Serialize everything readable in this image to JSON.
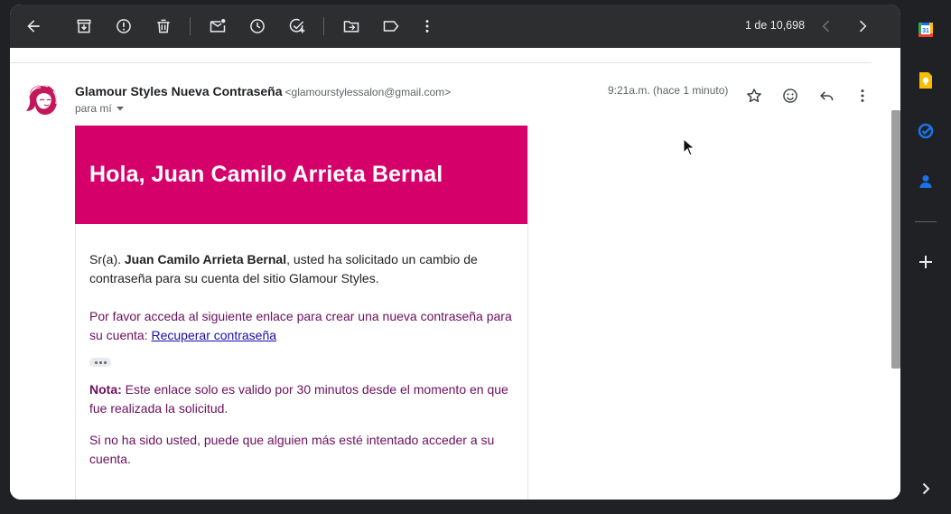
{
  "toolbar": {
    "pager_text": "1 de 10,698"
  },
  "message": {
    "sender_name": "Glamour Styles Nueva Contraseña",
    "sender_email": "<glamourstylessalon@gmail.com>",
    "recipient": "para mí",
    "time": "9:21a.m. (hace 1 minuto)"
  },
  "email_body": {
    "banner_title": "Hola, Juan Camilo Arrieta Bernal",
    "greeting_prefix": "Sr(a). ",
    "greeting_name": "Juan Camilo Arrieta Bernal",
    "greeting_rest": ", usted ha solicitado un cambio de contraseña para su cuenta del sitio Glamour Styles.",
    "instruction": "Por favor acceda al siguiente enlace para crear una nueva contraseña para su cuenta: ",
    "link_text": "Recuperar contraseña",
    "note_label": "Nota:",
    "note_text": " Este enlace solo es valido por 30 minutos desde el momento en que fue realizada la solicitud.",
    "warning": "Si no ha sido usted, puede que alguien más esté intentado acceder a su cuenta."
  },
  "colors": {
    "banner": "#d6006b",
    "body_purple": "#6b0f5e",
    "toolbar_bg": "#2d2e30",
    "page_bg": "#202124"
  },
  "icons": {
    "toolbar": [
      "back-arrow-icon",
      "archive-icon",
      "report-spam-icon",
      "delete-icon",
      "mark-unread-icon",
      "snooze-icon",
      "add-task-icon",
      "move-to-icon",
      "label-icon",
      "more-vert-icon",
      "chevron-left-icon",
      "chevron-right-icon"
    ],
    "header": [
      "star-icon",
      "emoji-icon",
      "reply-icon",
      "more-vert-icon"
    ],
    "side_panel": [
      "calendar-icon",
      "keep-icon",
      "tasks-icon",
      "contacts-icon",
      "add-icon",
      "expand-icon"
    ]
  }
}
